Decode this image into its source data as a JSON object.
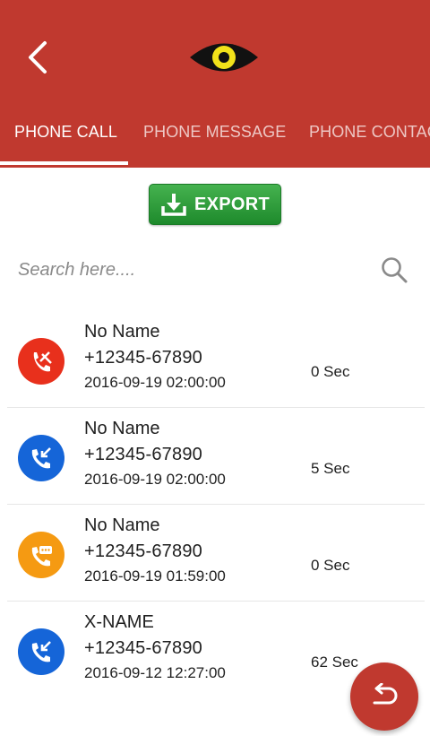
{
  "tabs": [
    {
      "label": "PHONE CALL",
      "active": true
    },
    {
      "label": "PHONE MESSAGE",
      "active": false
    },
    {
      "label": "PHONE CONTACT",
      "active": false
    }
  ],
  "export": {
    "label": "EXPORT"
  },
  "search": {
    "placeholder": "Search here....",
    "value": ""
  },
  "calls": [
    {
      "name": "No Name",
      "number": "+12345-67890",
      "date": "2016-09-19 02:00:00",
      "duration": "0 Sec",
      "type": "missed",
      "color": "#e8301c",
      "icon": "missed-call-icon"
    },
    {
      "name": "No Name",
      "number": "+12345-67890",
      "date": "2016-09-19 02:00:00",
      "duration": "5 Sec",
      "type": "incoming",
      "color": "#1565d8",
      "icon": "incoming-call-icon"
    },
    {
      "name": "No Name",
      "number": "+12345-67890",
      "date": "2016-09-19 01:59:00",
      "duration": "0 Sec",
      "type": "voicemail",
      "color": "#f59a12",
      "icon": "voicemail-call-icon"
    },
    {
      "name": "X-NAME",
      "number": "+12345-67890",
      "date": "2016-09-12 12:27:00",
      "duration": "62 Sec",
      "type": "incoming",
      "color": "#1565d8",
      "icon": "incoming-call-icon"
    }
  ],
  "colors": {
    "primary": "#c0392f",
    "export_green": "#2e9e3a",
    "eye_yellow": "#f2e21a"
  }
}
